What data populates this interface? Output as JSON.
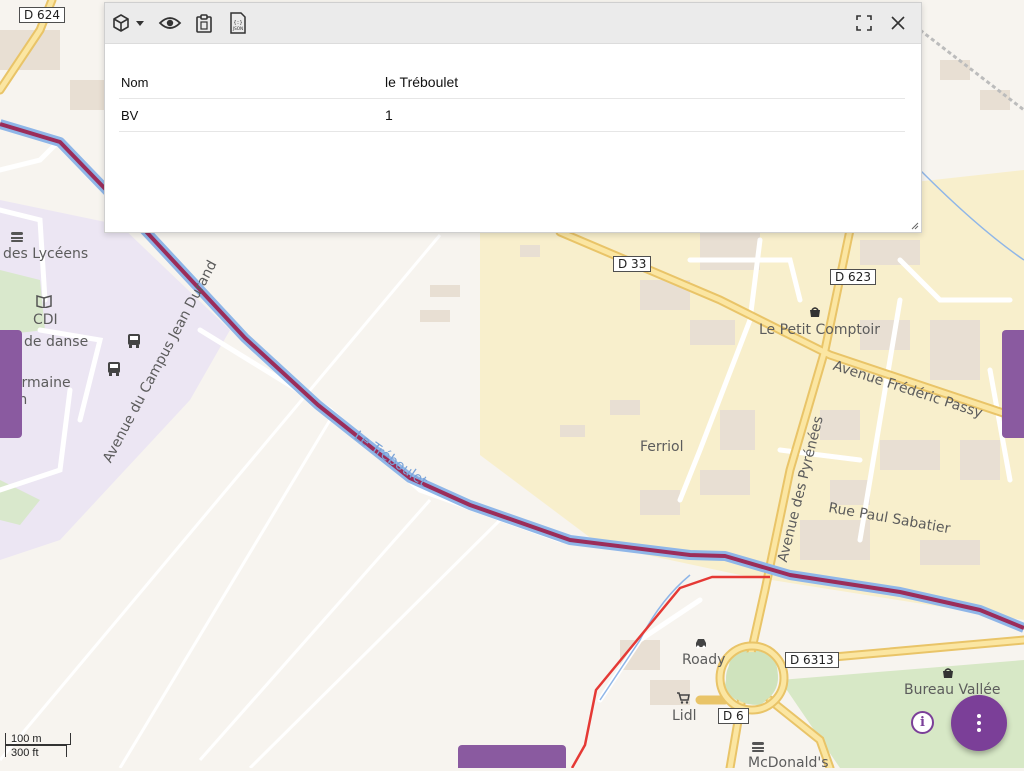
{
  "panel": {
    "rows": [
      {
        "key": "Nom",
        "value": "le Tréboulet"
      },
      {
        "key": "BV",
        "value": "1"
      }
    ]
  },
  "icons": {
    "layer": "cube-icon",
    "dropdown": "caret-down-icon",
    "view": "eye-icon",
    "copy": "clipboard-icon",
    "json": "json-file-icon",
    "fullscreen": "fullscreen-icon",
    "close": "close-icon",
    "menu": "more-vertical-icon",
    "info": "info-icon"
  },
  "json_icon_text": "JSON",
  "map": {
    "road_labels": [
      "D 624",
      "D 33",
      "D 623",
      "D 6313",
      "D 6"
    ],
    "place_labels": [
      "des Lycéens",
      "CDI",
      "de danse",
      "Germaine",
      "llon",
      "Le Petit Comptoir",
      "Ferriol",
      "Roady",
      "Lidl",
      "Bureau Vallée",
      "McDonald's"
    ],
    "street_labels": [
      "Avenue du Campus Jean Durand",
      "Avenue Frédéric Passy",
      "Avenue des Pyrénées",
      "Rue Paul Sabatier",
      "Le Tréboulet"
    ]
  },
  "scale": {
    "metric": "100 m",
    "imperial": "300 ft"
  },
  "info_label": "i",
  "colors": {
    "accent": "#7b3f98",
    "river": "#9b2d5a",
    "route": "#e53935"
  }
}
